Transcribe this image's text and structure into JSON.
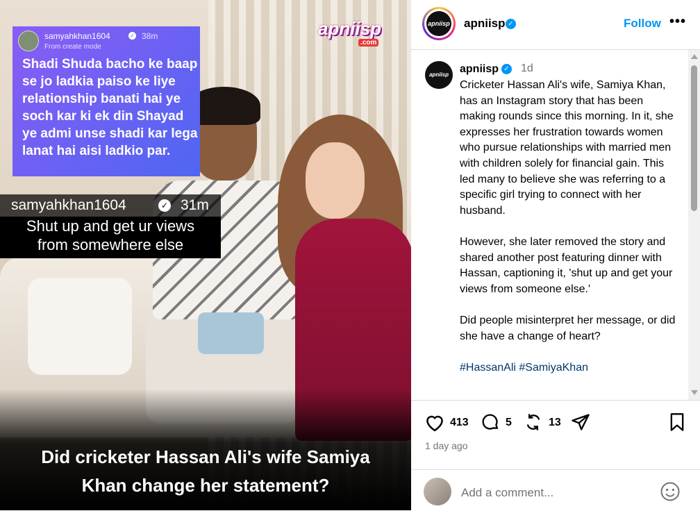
{
  "post_image": {
    "story": {
      "username": "samyahkhan1604",
      "time": "38m",
      "mode": "From create mode",
      "text": "Shadi Shuda bacho ke baap se jo ladkia paiso ke liye relationship banati hai ye soch kar ki ek din Shayad ye admi unse shadi kar lega lanat hai aisi ladkio par."
    },
    "brand": {
      "name": "apniisp",
      "suffix": ".com"
    },
    "reply": {
      "username": "samyahkhan1604",
      "time": "31m",
      "line1": "Shut up and get ur views",
      "line2": "from somewhere else"
    },
    "caption": {
      "line1": "Did cricketer Hassan Ali's wife Samiya",
      "line2": "Khan change her statement?"
    }
  },
  "header": {
    "username": "apniisp",
    "avatar_text": "apniisp",
    "follow_label": "Follow",
    "more_label": "•••"
  },
  "post": {
    "username": "apniisp",
    "time_ago": "1d",
    "paragraphs": [
      "Cricketer Hassan Ali's wife, Samiya Khan, has an Instagram story that has been making rounds since this morning. In it, she expresses her frustration towards women who pursue relationships with married men with children solely for financial gain. This led many to believe she was referring to a specific girl trying to connect with her husband.",
      "However, she later removed the story and shared another post featuring dinner with Hassan, captioning it, 'shut up and get your views from someone else.'",
      "Did people misinterpret her message, or did she have a change of heart?"
    ],
    "hashtags": "#HassanAli #SamiyaKhan"
  },
  "actions": {
    "likes": "413",
    "comments": "5",
    "reposts": "13"
  },
  "timestamp": "1 day ago",
  "comment": {
    "placeholder": "Add a comment..."
  },
  "colors": {
    "link": "#0095f6",
    "hashtag": "#00376b",
    "muted": "#737373"
  }
}
